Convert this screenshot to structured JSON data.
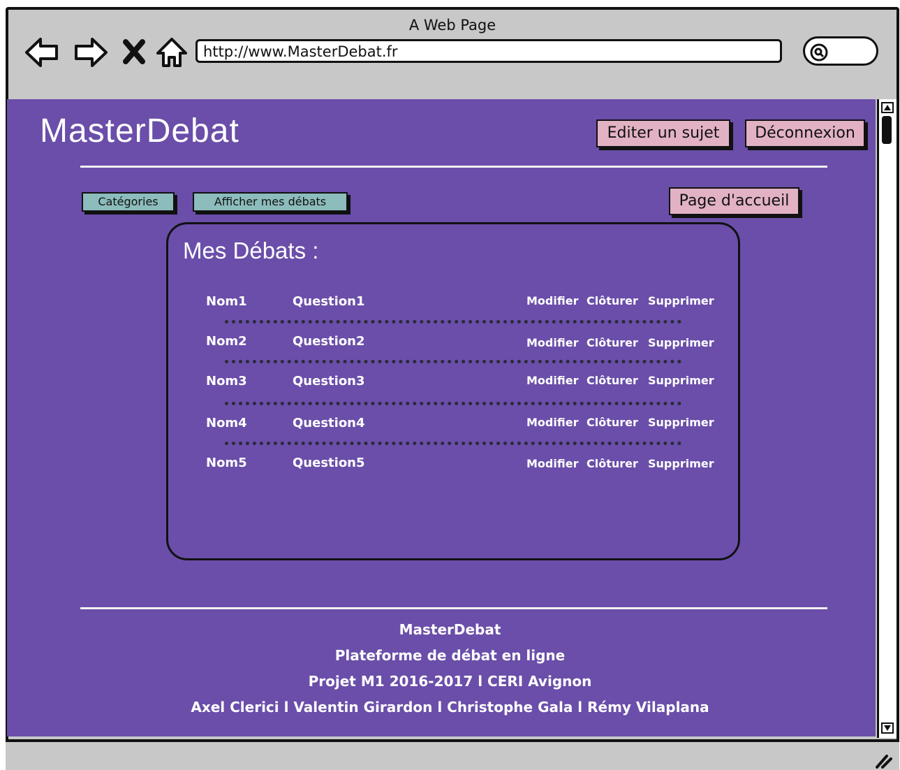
{
  "browser": {
    "title": "A Web Page",
    "url": "http://www.MasterDebat.fr"
  },
  "header": {
    "logo": "MasterDebat",
    "edit_label": "Editer un sujet",
    "logout_label": "Déconnexion"
  },
  "nav": {
    "categories_label": "Catégories",
    "my_debates_label": "Afficher mes débats",
    "home_label": "Page d'accueil"
  },
  "panel": {
    "title": "Mes Débats :",
    "rows": [
      {
        "name": "Nom1",
        "question": "Question1",
        "modify": "Modifier",
        "close": "Clôturer",
        "delete": "Supprimer"
      },
      {
        "name": "Nom2",
        "question": "Question2",
        "modify": "Modifier",
        "close": "Clôturer",
        "delete": "Supprimer"
      },
      {
        "name": "Nom3",
        "question": "Question3",
        "modify": "Modifier",
        "close": "Clôturer",
        "delete": "Supprimer"
      },
      {
        "name": "Nom4",
        "question": "Question4",
        "modify": "Modifier",
        "close": "Clôturer",
        "delete": "Supprimer"
      },
      {
        "name": "Nom5",
        "question": "Question5",
        "modify": "Modifier",
        "close": "Clôturer",
        "delete": "Supprimer"
      }
    ]
  },
  "footer": {
    "line1": "MasterDebat",
    "line2": "Plateforme de débat en ligne",
    "line3": "Projet M1 2016-2017 l CERI Avignon",
    "line4": "Axel Clerici l Valentin Girardon l Christophe Gala l Rémy Vilaplana"
  },
  "colors": {
    "page_bg": "#6a4ea9",
    "pink_button": "#e2b2c4",
    "teal_button": "#8cbcbc",
    "chrome": "#c8c8c8"
  },
  "icons": [
    "back-arrow-icon",
    "forward-arrow-icon",
    "close-icon",
    "home-icon",
    "search-icon",
    "scroll-up-icon",
    "scroll-down-icon",
    "resize-grip-icon"
  ]
}
